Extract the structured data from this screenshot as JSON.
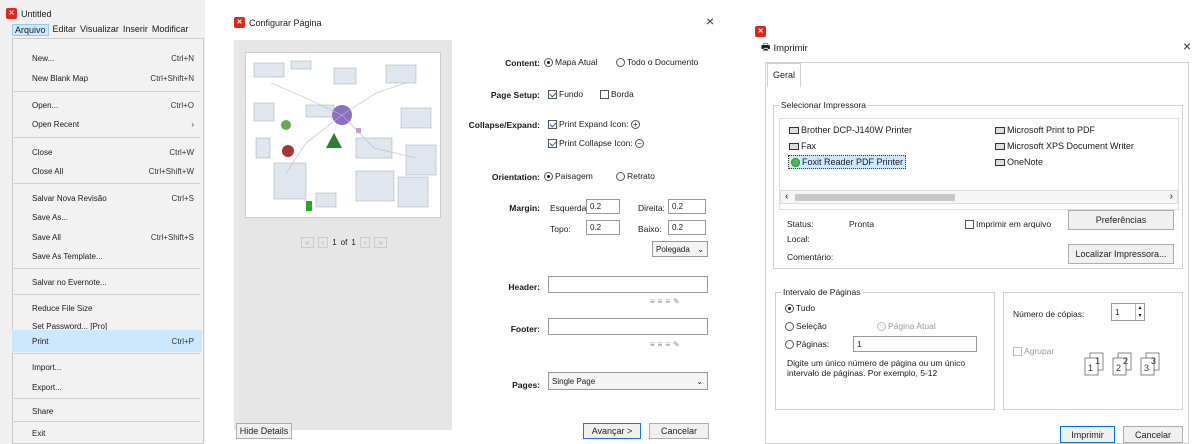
{
  "menu_panel": {
    "title": "Untitled",
    "menubar": [
      "Arquivo",
      "Editar",
      "Visualizar",
      "Inserir",
      "Modificar"
    ],
    "items": [
      {
        "label": "New...",
        "shortcut": "Ctrl+N"
      },
      {
        "label": "New Blank Map",
        "shortcut": "Ctrl+Shift+N"
      },
      {
        "label": "Open...",
        "shortcut": "Ctrl+O"
      },
      {
        "label": "Open Recent",
        "shortcut": "›"
      },
      {
        "label": "Close",
        "shortcut": "Ctrl+W"
      },
      {
        "label": "Close All",
        "shortcut": "Ctrl+Shift+W"
      },
      {
        "label": "Salvar Nova Revisão",
        "shortcut": "Ctrl+S"
      },
      {
        "label": "Save As...",
        "shortcut": ""
      },
      {
        "label": "Save All",
        "shortcut": "Ctrl+Shift+S"
      },
      {
        "label": "Save As Template...",
        "shortcut": ""
      },
      {
        "label": "Salvar no Evernote...",
        "shortcut": ""
      },
      {
        "label": "Reduce File Size",
        "shortcut": ""
      },
      {
        "label": "Set Password... [Pro]",
        "shortcut": ""
      },
      {
        "label": "Print",
        "shortcut": "Ctrl+P"
      },
      {
        "label": "Import...",
        "shortcut": ""
      },
      {
        "label": "Export...",
        "shortcut": ""
      },
      {
        "label": "Share",
        "shortcut": ""
      },
      {
        "label": "Exit",
        "shortcut": ""
      }
    ]
  },
  "page_setup": {
    "title": "Configurar Página",
    "close": "×",
    "pager": {
      "current": "1",
      "of": "of",
      "total": "1"
    },
    "content": {
      "label": "Content:",
      "opt1": "Mapa Atual",
      "opt2": "Todo o Documento"
    },
    "page_setup": {
      "label": "Page Setup:",
      "opt1": "Fundo",
      "opt2": "Borda"
    },
    "collapse": {
      "label": "Collapse/Expand:",
      "opt1": "Print Expand Icon:",
      "opt2": "Print Collapse Icon:"
    },
    "orientation": {
      "label": "Orientation:",
      "opt1": "Paisagem",
      "opt2": "Retrato"
    },
    "margin": {
      "label": "Margin:",
      "left_label": "Esquerda:",
      "left": "0.2",
      "right_label": "Direita:",
      "right": "0.2",
      "top_label": "Topo:",
      "top": "0.2",
      "bottom_label": "Baixo:",
      "bottom": "0.2",
      "unit": "Polegada"
    },
    "header": {
      "label": "Header:",
      "value": ""
    },
    "footer": {
      "label": "Footer:",
      "value": ""
    },
    "pages": {
      "label": "Pages:",
      "value": "Single Page"
    },
    "hide_details": "Hide Details",
    "next": "Avançar >",
    "cancel": "Cancelar"
  },
  "print_dialog": {
    "title": "Imprimir",
    "close": "×",
    "tab": "Geral",
    "printer_group": "Selecionar Impressora",
    "printers": [
      "Brother DCP-J140W Printer",
      "Microsoft Print to PDF",
      "Fax",
      "Microsoft XPS Document Writer",
      "Foxit Reader PDF Printer",
      "OneNote"
    ],
    "status_label": "Status:",
    "status_value": "Pronta",
    "local_label": "Local:",
    "comment_label": "Comentário:",
    "print_to_file": "Imprimir em arquivo",
    "preferences": "Preferências",
    "find_printer": "Localizar Impressora...",
    "range_group": "Intervalo de Páginas",
    "range_all": "Tudo",
    "range_selection": "Seleção",
    "range_current": "Página Atual",
    "range_pages": "Páginas:",
    "range_pages_value": "1",
    "range_hint": "Digite um único número de página ou um único intervalo de páginas. Por exemplo, 5-12",
    "copies_label": "Número de cópias:",
    "copies_value": "1",
    "collate": "Agrupar",
    "print": "Imprimir",
    "cancel": "Cancelar"
  },
  "colors": {
    "accent": "#cce8ff",
    "selected": "#0078d7",
    "brand": "#e2241b"
  }
}
